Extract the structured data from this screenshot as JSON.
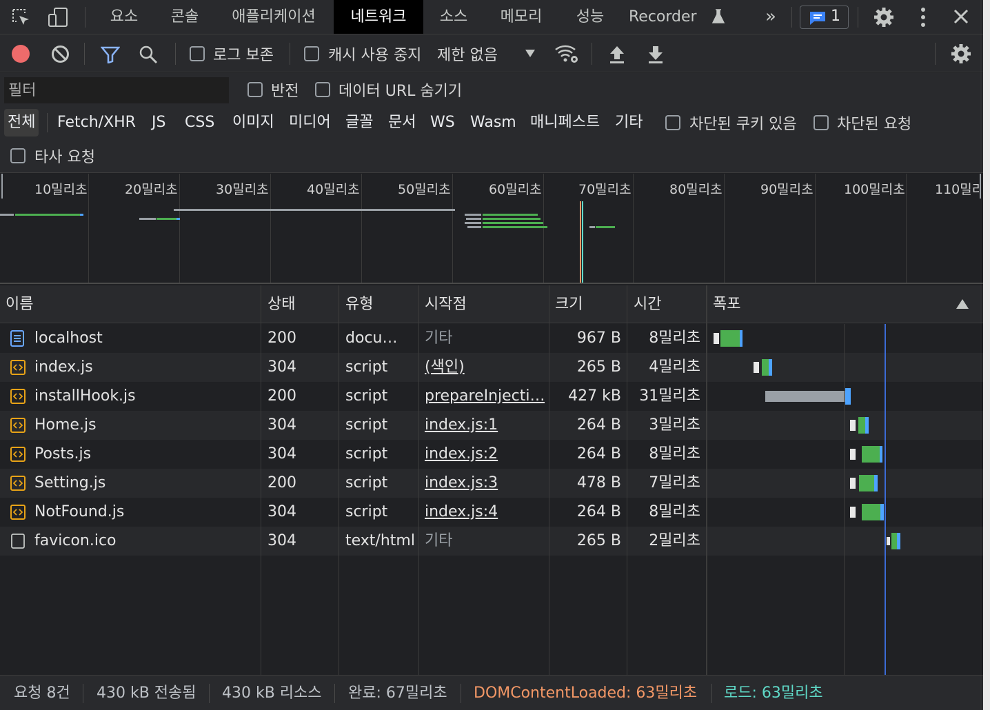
{
  "tabs": [
    "요소",
    "콘솔",
    "애플리케이션",
    "네트워크",
    "소스",
    "메모리",
    "성능",
    "Recorder"
  ],
  "active_tab": "네트워크",
  "more_tabs_label": "»",
  "issues_count": "1",
  "toolbar": {
    "preserve_log": "로그 보존",
    "disable_cache": "캐시 사용 중지",
    "throttle": "제한 없음"
  },
  "filter": {
    "placeholder": "필터",
    "invert": "반전",
    "hide_data_urls": "데이터 URL 숨기기",
    "types": [
      "전체",
      "Fetch/XHR",
      "JS",
      "CSS",
      "이미지",
      "미디어",
      "글꼴",
      "문서",
      "WS",
      "Wasm",
      "매니페스트",
      "기타"
    ],
    "blocked_cookies": "차단된 쿠키 있음",
    "blocked_requests": "차단된 요청",
    "third_party": "타사 요청"
  },
  "overview_ticks": [
    "10밀리초",
    "20밀리초",
    "30밀리초",
    "40밀리초",
    "50밀리초",
    "60밀리초",
    "70밀리초",
    "80밀리초",
    "90밀리초",
    "100밀리초",
    "110밀리"
  ],
  "columns": {
    "name": "이름",
    "status": "상태",
    "type": "유형",
    "initiator": "시작점",
    "size": "크기",
    "time": "시간",
    "waterfall": "폭포"
  },
  "requests": [
    {
      "name": "localhost",
      "status": "200",
      "type": "docu…",
      "initiator": "기타",
      "initiator_link": false,
      "size": "967 B",
      "time": "8밀리초",
      "icon": "document-icon"
    },
    {
      "name": "index.js",
      "status": "304",
      "type": "script",
      "initiator": "(색인)",
      "initiator_link": true,
      "size": "265 B",
      "time": "4밀리초",
      "icon": "script-icon"
    },
    {
      "name": "installHook.js",
      "status": "200",
      "type": "script",
      "initiator": "prepareInjecti…",
      "initiator_link": true,
      "size": "427 kB",
      "time": "31밀리초",
      "icon": "script-icon"
    },
    {
      "name": "Home.js",
      "status": "304",
      "type": "script",
      "initiator": "index.js:1",
      "initiator_link": true,
      "size": "264 B",
      "time": "3밀리초",
      "icon": "script-icon"
    },
    {
      "name": "Posts.js",
      "status": "304",
      "type": "script",
      "initiator": "index.js:2",
      "initiator_link": true,
      "size": "264 B",
      "time": "8밀리초",
      "icon": "script-icon"
    },
    {
      "name": "Setting.js",
      "status": "200",
      "type": "script",
      "initiator": "index.js:3",
      "initiator_link": true,
      "size": "478 B",
      "time": "7밀리초",
      "icon": "script-icon"
    },
    {
      "name": "NotFound.js",
      "status": "304",
      "type": "script",
      "initiator": "index.js:4",
      "initiator_link": true,
      "size": "264 B",
      "time": "8밀리초",
      "icon": "script-icon"
    },
    {
      "name": "favicon.ico",
      "status": "304",
      "type": "text/html",
      "initiator": "기타",
      "initiator_link": false,
      "size": "265 B",
      "time": "2밀리초",
      "icon": "blank-file-icon"
    }
  ],
  "status_bar": {
    "requests": "요청 8건",
    "transferred": "430 kB 전송됨",
    "resources": "430 kB 리소스",
    "finish": "완료: 67밀리초",
    "dom_content_loaded": "DOMContentLoaded: 63밀리초",
    "load": "로드: 63밀리초"
  },
  "colors": {
    "dom_content_loaded": "#f29766",
    "load": "#5fd9c7",
    "accent_blue": "#8ab4f8",
    "record_red": "#ee6b6b",
    "waterfall_green": "#4caf50",
    "waterfall_blue": "#4da3ff"
  }
}
